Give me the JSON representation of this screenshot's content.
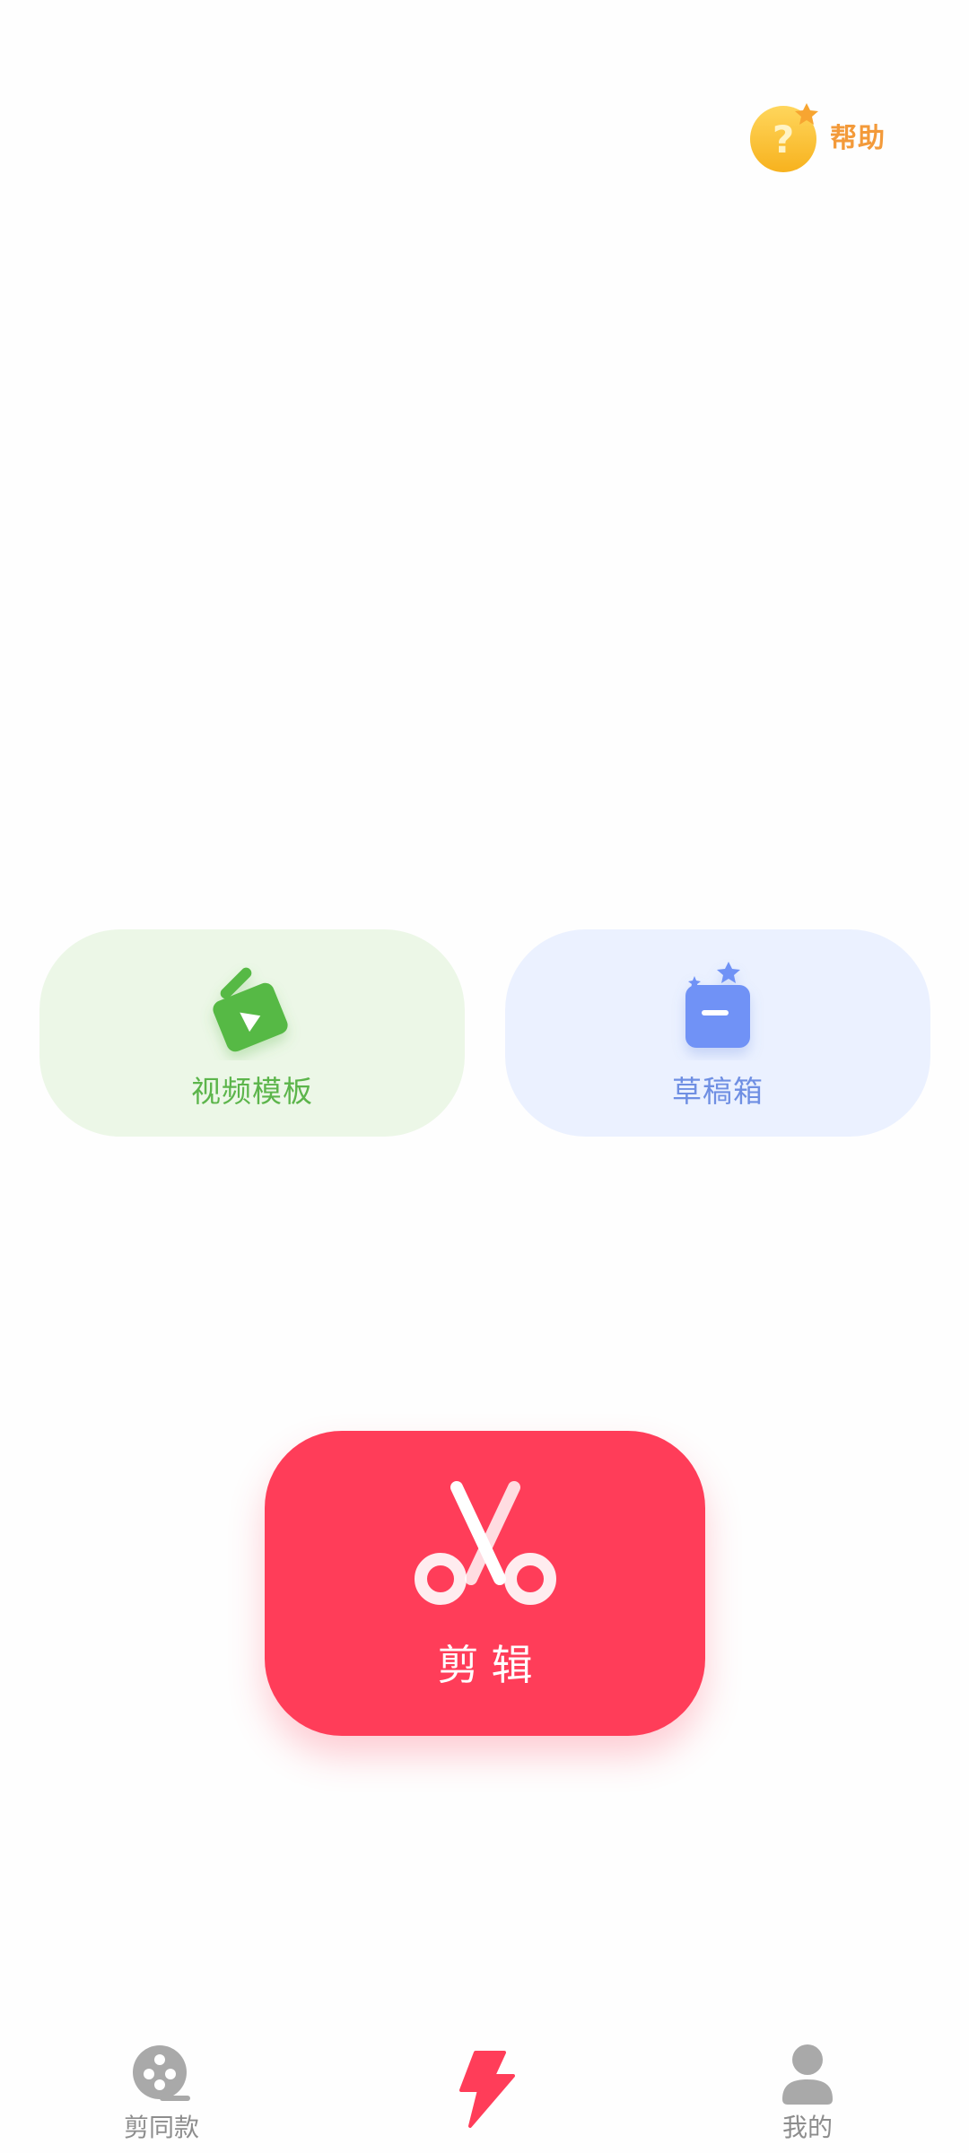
{
  "help": {
    "label": "帮助",
    "icon": "question-mark-icon"
  },
  "cards": {
    "templates": {
      "label": "视频模板",
      "icon": "video-clapper-icon",
      "color": "#5cb54b",
      "bg": "#ecf7e7"
    },
    "drafts": {
      "label": "草稿箱",
      "icon": "draft-box-icon",
      "color": "#6f8fe3",
      "bg": "#ebf1ff"
    }
  },
  "edit": {
    "label": "剪辑",
    "icon": "scissors-icon",
    "color": "#ff3d59"
  },
  "tabbar": {
    "items": [
      {
        "label": "剪同款",
        "icon": "film-reel-icon",
        "active": false
      },
      {
        "label": "",
        "icon": "lightning-icon",
        "active": true
      },
      {
        "label": "我的",
        "icon": "person-icon",
        "active": false
      }
    ]
  }
}
